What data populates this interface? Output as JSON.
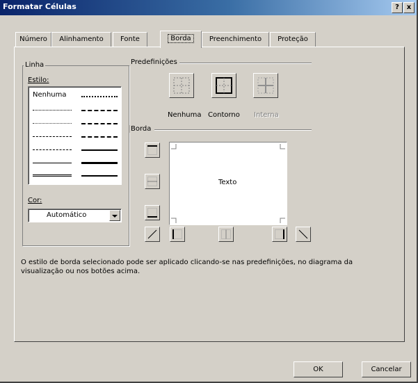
{
  "window": {
    "title": "Formatar Células",
    "help_button": "?",
    "close_button": "x"
  },
  "tabs": [
    "Número",
    "Alinhamento",
    "Fonte",
    "Borda",
    "Preenchimento",
    "Proteção"
  ],
  "active_tab": "Borda",
  "linha": {
    "legend": "Linha",
    "estilo_label": "Estilo:",
    "nenhuma_label": "Nenhuma",
    "cor_label": "Cor:",
    "cor_value": "Automático"
  },
  "predefinicoes": {
    "legend": "Predefinições",
    "buttons": [
      {
        "label": "Nenhuma",
        "disabled": false
      },
      {
        "label": "Contorno",
        "disabled": false
      },
      {
        "label": "Interna",
        "disabled": true
      }
    ]
  },
  "borda": {
    "legend": "Borda",
    "preview_text": "Texto"
  },
  "description": "O estilo de borda selecionado pode ser aplicado clicando-se nas predefinições, no diagrama da visualização ou nos botões acima.",
  "buttons": {
    "ok": "OK",
    "cancel": "Cancelar"
  }
}
